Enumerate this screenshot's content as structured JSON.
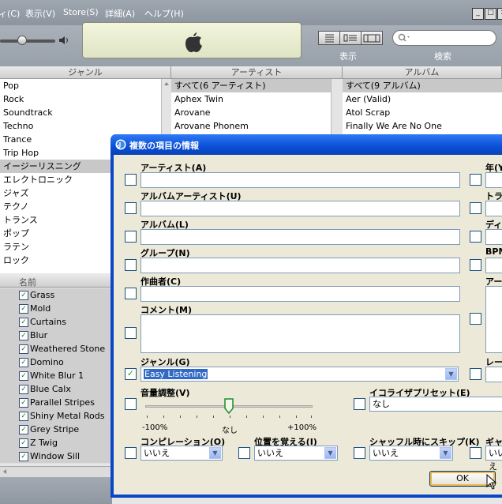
{
  "menu": {
    "items": [
      "ィ(C)",
      "表示(V)",
      "Store(S)",
      "詳細(A)",
      "ヘルプ(H)"
    ],
    "window_buttons": [
      "_",
      "□",
      "×"
    ]
  },
  "toolbar": {
    "view_label": "表示",
    "search_label": "検索",
    "search_placeholder": ""
  },
  "browser": {
    "genre_header": "ジャンル",
    "artist_header": "アーティスト",
    "album_header": "アルバム",
    "genres": [
      "Pop",
      "Rock",
      "Soundtrack",
      "Techno",
      "Trance",
      "Trip Hop",
      "イージーリスニング",
      "エレクトロニック",
      "ジャズ",
      "テクノ",
      "トランス",
      "ポップ",
      "ラテン",
      "ロック"
    ],
    "selected_genre_index": 6,
    "artists": [
      "すべて(6 アーティスト)",
      "Aphex Twin",
      "Arovane",
      "Arovane Phonem"
    ],
    "albums": [
      "すべて(9 アルバム)",
      "Aer (Valid)",
      "Atol Scrap",
      "Finally We Are No One"
    ]
  },
  "tracklist": {
    "name_header": "名前",
    "tracks": [
      "Grass",
      "Mold",
      "Curtains",
      "Blur",
      "Weathered Stone",
      "Domino",
      "White Blur 1",
      "Blue Calx",
      "Parallel Stripes",
      "Shiny Metal Rods",
      "Grey Stripe",
      "Z Twig",
      "Window Sill"
    ]
  },
  "dialog": {
    "title": "複数の項目の情報",
    "fields": {
      "artist": "アーティスト(A)",
      "album_artist": "アルバムアーティスト(U)",
      "album": "アルバム(L)",
      "grouping": "グループ(N)",
      "composer": "作曲者(C)",
      "comment": "コメント(M)",
      "genre": "ジャンル(G)",
      "volume": "音量調整(V)",
      "eq_preset": "イコライザプリセット(E)",
      "compilation": "コンピレーション(O)",
      "remember_position": "位置を覚える(I)",
      "skip_shuffle": "シャッフル時にスキップ(K)"
    },
    "right_labels": [
      "年(Y",
      "トラッ",
      "ディス",
      "BPM",
      "アー",
      "レー",
      "ギャ"
    ],
    "genre_value": "Easy Listening",
    "eq_value": "なし",
    "compilation_value": "いいえ",
    "remember_value": "いいえ",
    "skip_value": "いいえ",
    "extra_value": "いいえ",
    "volume_min": "-100%",
    "volume_mid": "なし",
    "volume_max": "+100%",
    "volume_level": 0.5,
    "ok_label": "OK"
  },
  "colors": {
    "dialog_title": "#0a4fd6",
    "dialog_body": "#ece9d8",
    "selected_text_bg": "#316ac5"
  }
}
